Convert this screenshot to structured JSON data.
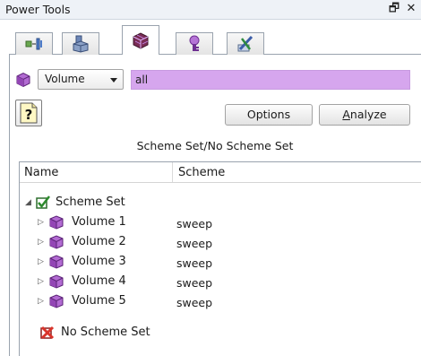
{
  "window": {
    "title": "Power Tools",
    "float_glyph": "🗗",
    "close_glyph": "✕"
  },
  "tabs": [
    {
      "icon": "geometry-power-tool-icon",
      "active": false
    },
    {
      "icon": "mesh-power-tool-icon",
      "active": false
    },
    {
      "icon": "meshing-scheme-icon",
      "active": true
    },
    {
      "icon": "mesh-quality-icon",
      "active": false
    },
    {
      "icon": "repair-tool-icon",
      "active": false
    }
  ],
  "toolbar": {
    "entity_type": "Volume",
    "entity_type_options": [
      "Volume"
    ],
    "id_value": "all",
    "options_label": "Options",
    "analyze_label": "Analyze",
    "analyze_mnemonic": "A",
    "analyze_rest": "nalyze"
  },
  "caption": "Scheme Set/No Scheme Set",
  "tree": {
    "columns": [
      "Name",
      "Scheme"
    ],
    "root": {
      "label": "Scheme Set",
      "icon": "green-checkbox-icon",
      "expanded": true
    },
    "children": [
      {
        "label": "Volume 1",
        "scheme": "sweep"
      },
      {
        "label": "Volume 2",
        "scheme": "sweep"
      },
      {
        "label": "Volume 3",
        "scheme": "sweep"
      },
      {
        "label": "Volume 4",
        "scheme": "sweep"
      },
      {
        "label": "Volume 5",
        "scheme": "sweep"
      }
    ],
    "no_scheme": {
      "label": "No Scheme Set",
      "icon": "red-x-icon"
    }
  },
  "colors": {
    "id_field_bg": "#d6a6ee",
    "volume_icon": "#a64ec4",
    "check_green": "#2d8a2d",
    "no_scheme_red": "#d9342b"
  }
}
